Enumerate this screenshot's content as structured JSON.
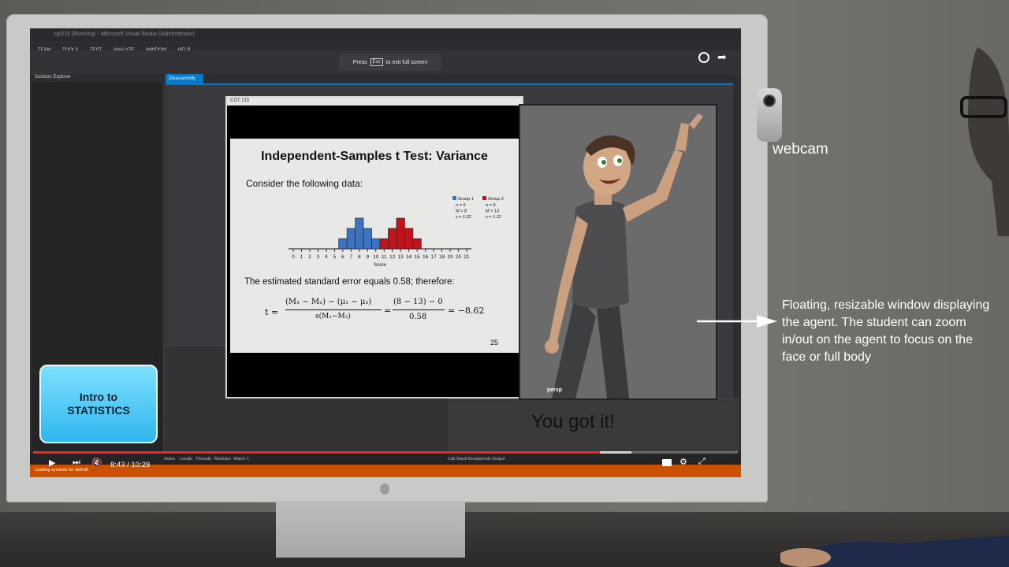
{
  "vs": {
    "title": "cgt215 (Running) - Microsoft Visual Studio (Administrator)",
    "menu": [
      "TEAM",
      "TOOLS",
      "TEST",
      "ANALYZE",
      "WINDOW",
      "HELP"
    ],
    "solution_explorer": "Solution Explorer",
    "doc_tab": "Disassembly",
    "status_tabs": [
      "Autos",
      "Locals",
      "Threads",
      "Modules",
      "Watch 1"
    ],
    "right_tabs": [
      "Call Stack",
      "Breakpoints",
      "Output"
    ],
    "status_text": "Loading symbols for ntdll.dll"
  },
  "esc_banner": {
    "press": "Press",
    "key": "Esc",
    "rest": "to exit full screen"
  },
  "slide_window": {
    "title": "CGT 215",
    "slide": {
      "title": "Independent-Samples t Test: Variance",
      "consider": "Consider the following data:",
      "se_line": "The estimated standard error equals 0.58; therefore:",
      "page": "25",
      "formula": {
        "t": "t =",
        "num1": "(M₁ − M₂) − (μ₁ − μ₂)",
        "den1": "s(M₁−M₂)",
        "num2": "(8 − 13) − 0",
        "den2": "0.58",
        "result": "= −8.62"
      }
    }
  },
  "chart_data": {
    "type": "bar",
    "xlabel": "Score",
    "x_ticks": [
      0,
      1,
      2,
      3,
      4,
      5,
      6,
      7,
      8,
      9,
      10,
      11,
      12,
      13,
      14,
      15,
      16,
      17,
      18,
      19,
      20,
      21
    ],
    "series": [
      {
        "name": "Group 1",
        "color": "#3b74c2",
        "x": [
          6,
          7,
          8,
          9,
          10
        ],
        "values": [
          1,
          2,
          3,
          2,
          1
        ],
        "stats": [
          "n = 9",
          "M = 8",
          "s = 1.22"
        ]
      },
      {
        "name": "Group 2",
        "color": "#c0141c",
        "x": [
          11,
          12,
          13,
          14,
          15
        ],
        "values": [
          1,
          2,
          3,
          2,
          1
        ],
        "stats": [
          "n = 9",
          "M = 13",
          "s = 1.22"
        ]
      }
    ]
  },
  "agent": {
    "label": "persp"
  },
  "video": {
    "time": "8:43 / 10:29",
    "progress": 0.806
  },
  "intro_button": {
    "line1": "Intro to",
    "line2": "STATISTICS"
  },
  "feedback": "You got it!",
  "webcam_label": "webcam",
  "annotation": "Floating, resizable window displaying the agent. The student can zoom in/out on the agent to focus on the face or full body",
  "icons": [
    "play-icon",
    "next-icon",
    "mute-icon",
    "settings-icon",
    "fullscreen-icon",
    "clock-icon",
    "share-icon"
  ]
}
